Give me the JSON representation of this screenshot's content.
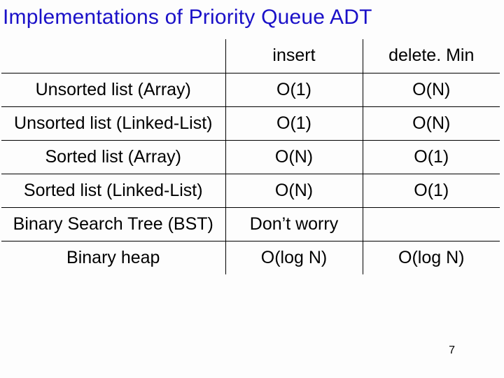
{
  "title": "Implementations of Priority Queue ADT",
  "table": {
    "header": {
      "c1": "insert",
      "c2": "delete. Min"
    },
    "rows": [
      {
        "name": "Unsorted list (Array)",
        "insert": "O(1)",
        "deleteMin": "O(N)"
      },
      {
        "name": "Unsorted list (Linked-List)",
        "insert": "O(1)",
        "deleteMin": "O(N)"
      },
      {
        "name": "Sorted list (Array)",
        "insert": "O(N)",
        "deleteMin": "O(1)"
      },
      {
        "name": "Sorted list (Linked-List)",
        "insert": "O(N)",
        "deleteMin": "O(1)"
      },
      {
        "name": "Binary Search Tree (BST)",
        "insert": "Don’t worry",
        "deleteMin": ""
      },
      {
        "name": "Binary heap",
        "insert": "O(log N)",
        "deleteMin": "O(log N)"
      }
    ]
  },
  "pageNumber": "7"
}
